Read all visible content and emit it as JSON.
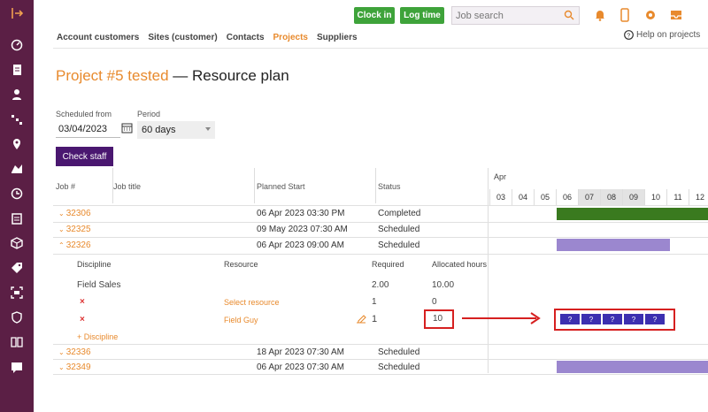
{
  "topbar": {
    "clock_in": "Clock in",
    "log_time": "Log time",
    "search_placeholder": "Job search"
  },
  "nav": {
    "items": [
      "Account customers",
      "Sites (customer)",
      "Contacts",
      "Projects",
      "Suppliers"
    ],
    "active": "Projects",
    "help": "Help on projects"
  },
  "title": {
    "project": "Project #5 tested",
    "suffix": " — Resource plan"
  },
  "form": {
    "scheduled_from_label": "Scheduled from",
    "scheduled_from_value": "03/04/2023",
    "period_label": "Period",
    "period_value": "60 days",
    "check_staff": "Check staff"
  },
  "table": {
    "headers": {
      "job": "Job #",
      "job_title": "Job title",
      "planned_start": "Planned Start",
      "status": "Status"
    },
    "rows": [
      {
        "job": "32306",
        "start": "06 Apr 2023 03:30 PM",
        "status": "Completed"
      },
      {
        "job": "32325",
        "start": "09 May 2023 07:30 AM",
        "status": "Scheduled"
      },
      {
        "job": "32326",
        "start": "06 Apr 2023 09:00 AM",
        "status": "Scheduled"
      },
      {
        "job": "32336",
        "start": "18 Apr 2023 07:30 AM",
        "status": "Scheduled"
      },
      {
        "job": "32349",
        "start": "06 Apr 2023 07:30 AM",
        "status": "Scheduled"
      }
    ],
    "sub": {
      "headers": {
        "discipline": "Discipline",
        "resource": "Resource",
        "required": "Required",
        "allocated": "Allocated hours"
      },
      "discipline_name": "Field Sales",
      "discipline_required": "2.00",
      "discipline_allocated": "10.00",
      "rows": [
        {
          "resource": "Select resource",
          "required": "1",
          "allocated": "0"
        },
        {
          "resource": "Field Guy",
          "required": "1",
          "allocated": "10"
        }
      ],
      "add_discipline": "+ Discipline"
    }
  },
  "gantt": {
    "month": "Apr",
    "days": [
      "03",
      "04",
      "05",
      "06",
      "07",
      "08",
      "09",
      "10",
      "11",
      "12"
    ],
    "shaded_days": [
      "07",
      "08",
      "09"
    ],
    "allocation_cells": [
      "?",
      "?",
      "?",
      "?",
      "?"
    ],
    "colors": {
      "completed": "#3a7a1f",
      "scheduled": "#9b87cf",
      "allocation": "#3c2fb0",
      "highlight": "#d62020"
    }
  }
}
